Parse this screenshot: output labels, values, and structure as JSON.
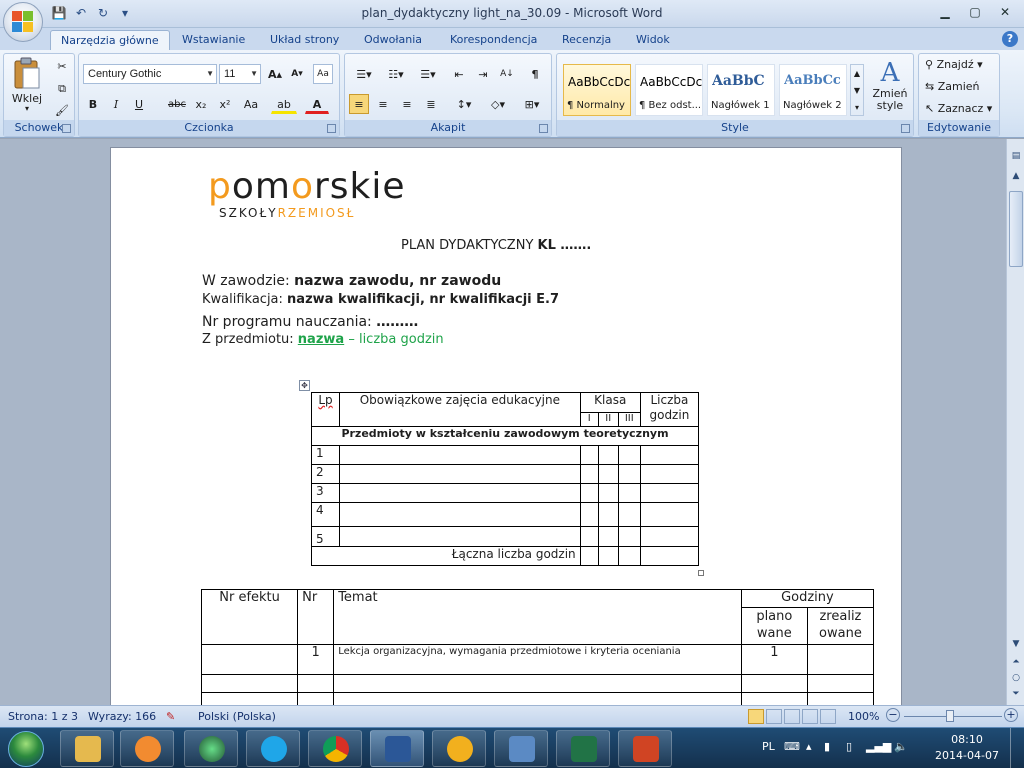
{
  "window": {
    "title": "plan_dydaktyczny light_na_30.09 - Microsoft Word",
    "qat": {
      "save": "💾",
      "undo": "↶",
      "redo": "↻",
      "customize": "▾"
    },
    "controls": {
      "minimize": "▁",
      "maximize": "▢",
      "close": "✕"
    }
  },
  "tabs": [
    "Narzędzia główne",
    "Wstawianie",
    "Układ strony",
    "Odwołania",
    "Korespondencja",
    "Recenzja",
    "Widok"
  ],
  "ribbon": {
    "clipboard": {
      "label": "Schowek",
      "paste": "Wklej",
      "paste_arrow": "▾"
    },
    "font": {
      "label": "Czcionka",
      "name": "Century Gothic",
      "size": "11",
      "grow": "A",
      "shrink": "A",
      "clear": "Aa",
      "bold": "B",
      "italic": "I",
      "underline": "U",
      "strike": "abc",
      "sub": "x₂",
      "sup": "x²",
      "case": "Aa",
      "highlight": "ab",
      "color": "A"
    },
    "paragraph": {
      "label": "Akapit",
      "pilcrow": "¶",
      "sort": "A↓"
    },
    "styles": {
      "label": "Style",
      "items": [
        {
          "sample": "AaBbCcDc",
          "name": "¶ Normalny"
        },
        {
          "sample": "AaBbCcDc",
          "name": "¶ Bez odst..."
        },
        {
          "sample": "AaBbC",
          "name": "Nagłówek 1"
        },
        {
          "sample": "AaBbCc",
          "name": "Nagłówek 2"
        }
      ],
      "change": "Zmień style"
    },
    "editing": {
      "label": "Edytowanie",
      "find": "Znajdź",
      "replace": "Zamień",
      "select": "Zaznacz"
    }
  },
  "document": {
    "logo_word_1": "p",
    "logo_word_2": "om",
    "logo_word_3": "o",
    "logo_word_4": "rskie",
    "logo_sub_1": "SZKOŁY",
    "logo_sub_2": "RZEMIOSŁ",
    "plan_prefix": "PLAN DYDAKTYCZNY ",
    "plan_bold": "KL",
    "plan_suffix": " …….",
    "zawod_label": "W zawodzie: ",
    "zawod_value": "nazwa zawodu, nr zawodu",
    "kwal_label": "Kwalifikacja:  ",
    "kwal_value": "nazwa kwalifikacji, nr kwalifikacji   E.7",
    "program_label": "Nr programu nauczania: ",
    "program_value": "………",
    "przedmiot_label": "Z przedmiotu: ",
    "przedmiot_name": "nazwa",
    "przedmiot_hours": " – liczba godzin",
    "table1": {
      "h_lp": "Lp",
      "h_zajecia": "Obowiązkowe zajęcia edukacyjne",
      "h_klasa": "Klasa",
      "h_k1": "I",
      "h_k2": "II",
      "h_k3": "III",
      "h_liczba": "Liczba godzin",
      "section": "Przedmioty  w  kształceniu  zawodowym  teoretycznym",
      "rows": [
        "1",
        "2",
        "3",
        "4",
        "5"
      ],
      "total": "Łączna liczba godzin"
    },
    "table2": {
      "h_efekt": "Nr efektu",
      "h_nr": "Nr",
      "h_temat": "Temat",
      "h_godziny": "Godziny",
      "h_plan": "plano wane",
      "h_zreal": "zrealiz owane",
      "r1_nr": "1",
      "r1_temat": "Lekcja organizacyjna,  wymagania przedmiotowe i kryteria oceniania",
      "r1_plan": "1"
    }
  },
  "status": {
    "page": "Strona: 1 z 3",
    "words": "Wyrazy: 166",
    "language": "Polski (Polska)",
    "zoom": "100%",
    "zoom_minus": "−",
    "zoom_plus": "+"
  },
  "taskbar": {
    "lang": "PL",
    "time": "08:10",
    "date": "2014-04-07"
  },
  "colors": {
    "accent": "#1fa34a",
    "logo_orange": "#f39a1e"
  }
}
